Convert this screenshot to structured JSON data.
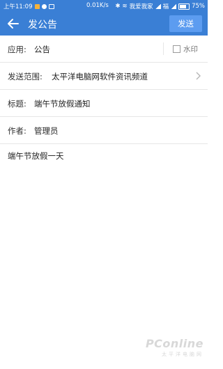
{
  "status_bar": {
    "time": "上午11:09",
    "network_speed": "0.01K/s",
    "carrier": "我爱我家",
    "carrier2": "福",
    "battery": "75%",
    "icons": [
      "notification-icon",
      "qq-icon",
      "mail-icon",
      "bluetooth-icon",
      "wifi-icon",
      "signal-icon",
      "battery-icon"
    ]
  },
  "header": {
    "back_icon": "back-arrow-icon",
    "title": "发公告",
    "send_label": "发送",
    "bar_color": "#3a7fd5",
    "button_color": "#5c9cf0"
  },
  "form": {
    "app_label": "应用:",
    "app_value": "公告",
    "watermark_label": "水印",
    "watermark_checked": false,
    "scope_label": "发送范围:",
    "scope_value": "太平洋电脑网软件资讯频道",
    "title_label": "标题:",
    "title_value": "端午节放假通知",
    "author_label": "作者:",
    "author_value": "管理员",
    "body": "端午节放假一天"
  },
  "brand": {
    "name": "PConline",
    "sub": "太平洋电脑网"
  }
}
